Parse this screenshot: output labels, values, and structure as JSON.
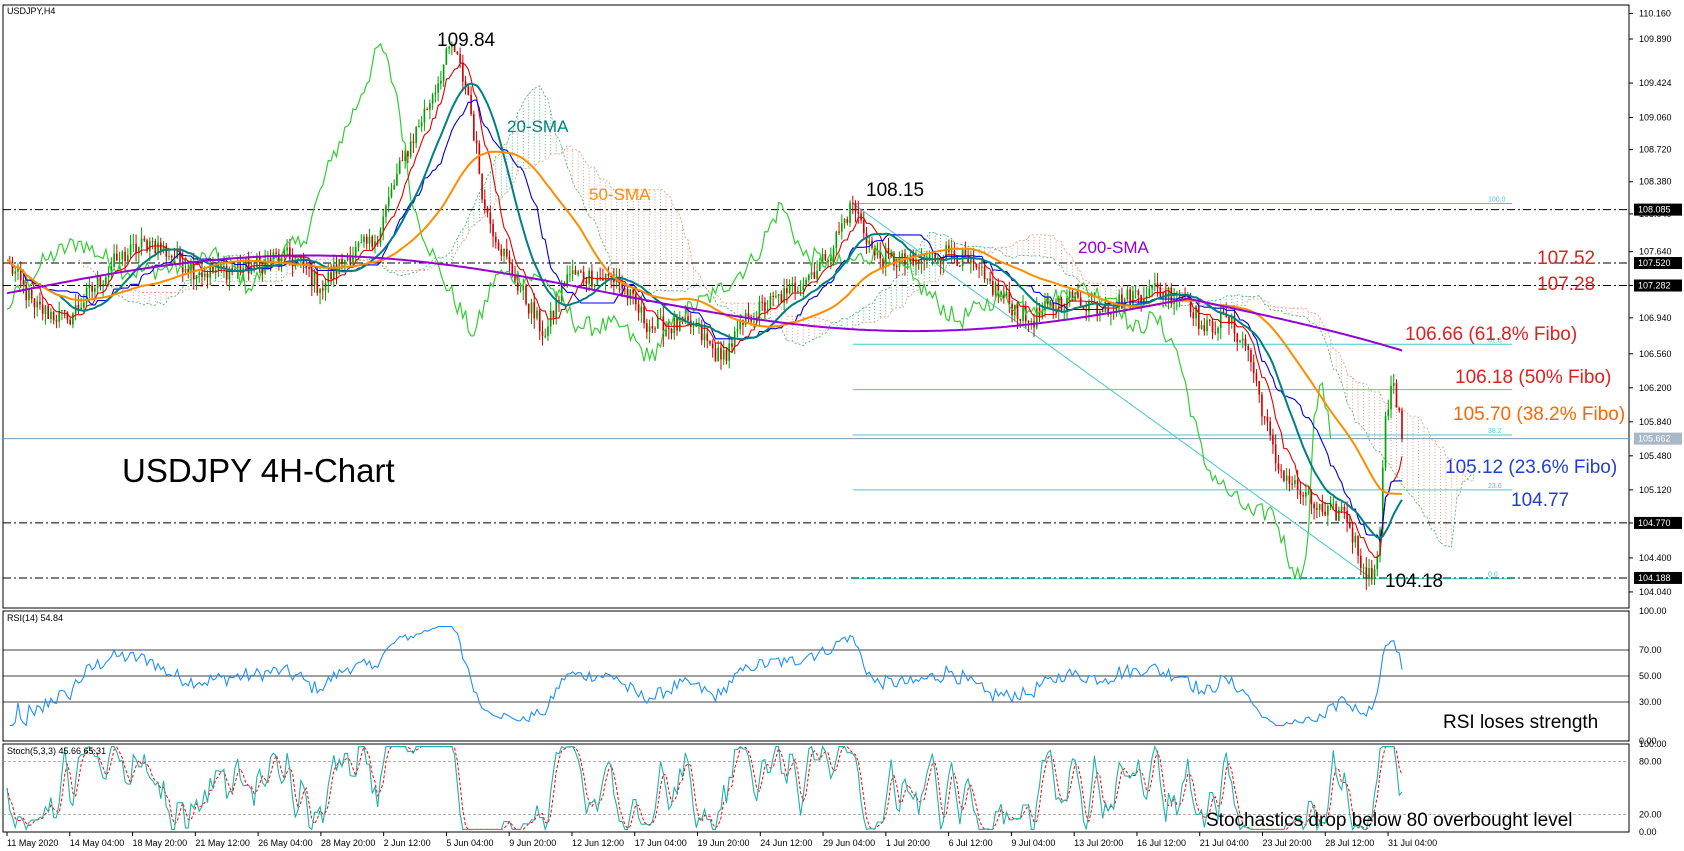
{
  "chart_data": [
    {
      "type": "line",
      "panel": "main",
      "symbol_label": "USDJPY,H4",
      "title": "USDJPY 4H-Chart",
      "ylim": [
        103.87,
        110.25
      ],
      "y_ticks": [
        "110.160",
        "109.890",
        "109.424",
        "109.060",
        "108.720",
        "108.380",
        "108.040",
        "107.640",
        "107.282",
        "106.940",
        "106.560",
        "106.200",
        "105.840",
        "105.480",
        "105.120",
        "104.770",
        "104.400",
        "104.040"
      ],
      "x_ticks": [
        "11 May 2020",
        "14 May 04:00",
        "18 May 20:00",
        "21 May 12:00",
        "26 May 04:00",
        "28 May 20:00",
        "2 Jun 12:00",
        "5 Jun 04:00",
        "9 Jun 20:00",
        "12 Jun 12:00",
        "17 Jun 04:00",
        "19 Jun 20:00",
        "24 Jun 12:00",
        "29 Jun 04:00",
        "1 Jul 20:00",
        "6 Jul 12:00",
        "9 Jul 04:00",
        "13 Jul 20:00",
        "16 Jul 12:00",
        "21 Jul 04:00",
        "23 Jul 20:00",
        "28 Jul 12:00",
        "31 Jul 04:00"
      ],
      "price_boxes": [
        {
          "value": 108.085,
          "label": "108.085"
        },
        {
          "value": 107.52,
          "label": "107.520"
        },
        {
          "value": 107.282,
          "label": "107.282"
        },
        {
          "value": 105.662,
          "label": "105.662"
        },
        {
          "value": 104.77,
          "label": "104.770"
        },
        {
          "value": 104.188,
          "label": "104.188"
        }
      ],
      "horizontal_levels": [
        108.085,
        107.52,
        107.282,
        104.77,
        104.188
      ],
      "current_price": 105.662,
      "fibo": {
        "high": 108.15,
        "low": 104.18,
        "levels": [
          {
            "value": 108.15,
            "small_label": "100.0"
          },
          {
            "value": 106.66,
            "small_label": "61.8"
          },
          {
            "value": 106.18,
            "small_label": ""
          },
          {
            "value": 105.7,
            "small_label": "38.2"
          },
          {
            "value": 105.12,
            "small_label": "23.6"
          },
          {
            "value": 104.18,
            "small_label": "0.0"
          }
        ]
      },
      "annotations": [
        {
          "text": "109.84",
          "color": "#000000"
        },
        {
          "text": "108.15",
          "color": "#000000"
        },
        {
          "text": "104.18",
          "color": "#000000"
        },
        {
          "text": "20-SMA",
          "color": "#008080"
        },
        {
          "text": "50-SMA",
          "color": "#ff8c00"
        },
        {
          "text": "200-SMA",
          "color": "#9400d3"
        },
        {
          "text": "107.52",
          "color": "#e02020"
        },
        {
          "text": "107.28",
          "color": "#e02020"
        },
        {
          "text": "106.66 (61.8% Fibo)",
          "color": "#e02020"
        },
        {
          "text": "106.18 (50% Fibo)",
          "color": "#e02020"
        },
        {
          "text": "105.70 (38.2% Fibo)",
          "color": "#ff6600"
        },
        {
          "text": "105.12 (23.6% Fibo)",
          "color": "#1f3fd1"
        },
        {
          "text": "104.77",
          "color": "#1f3fd1"
        }
      ],
      "anchors": [
        {
          "t": 0,
          "p": 107.55
        },
        {
          "t": 10,
          "p": 107.05
        },
        {
          "t": 22,
          "p": 106.92
        },
        {
          "t": 40,
          "p": 107.55
        },
        {
          "t": 52,
          "p": 107.75
        },
        {
          "t": 70,
          "p": 107.42
        },
        {
          "t": 90,
          "p": 107.48
        },
        {
          "t": 100,
          "p": 107.6
        },
        {
          "t": 108,
          "p": 107.5
        },
        {
          "t": 114,
          "p": 107.25
        },
        {
          "t": 124,
          "p": 107.6
        },
        {
          "t": 134,
          "p": 107.75
        },
        {
          "t": 144,
          "p": 108.6
        },
        {
          "t": 155,
          "p": 109.3
        },
        {
          "t": 162,
          "p": 109.84
        },
        {
          "t": 168,
          "p": 109.3
        },
        {
          "t": 174,
          "p": 108.1
        },
        {
          "t": 184,
          "p": 107.4
        },
        {
          "t": 196,
          "p": 106.75
        },
        {
          "t": 204,
          "p": 107.4
        },
        {
          "t": 222,
          "p": 107.35
        },
        {
          "t": 234,
          "p": 106.85
        },
        {
          "t": 250,
          "p": 106.85
        },
        {
          "t": 260,
          "p": 106.5
        },
        {
          "t": 270,
          "p": 106.95
        },
        {
          "t": 284,
          "p": 107.2
        },
        {
          "t": 298,
          "p": 107.55
        },
        {
          "t": 308,
          "p": 108.15
        },
        {
          "t": 316,
          "p": 107.6
        },
        {
          "t": 330,
          "p": 107.5
        },
        {
          "t": 344,
          "p": 107.65
        },
        {
          "t": 356,
          "p": 107.35
        },
        {
          "t": 372,
          "p": 106.9
        },
        {
          "t": 386,
          "p": 107.15
        },
        {
          "t": 400,
          "p": 107.05
        },
        {
          "t": 416,
          "p": 107.25
        },
        {
          "t": 430,
          "p": 107.15
        },
        {
          "t": 436,
          "p": 106.8
        },
        {
          "t": 444,
          "p": 106.95
        },
        {
          "t": 452,
          "p": 106.6
        },
        {
          "t": 462,
          "p": 105.4
        },
        {
          "t": 472,
          "p": 105.05
        },
        {
          "t": 480,
          "p": 104.85
        },
        {
          "t": 487,
          "p": 104.9
        },
        {
          "t": 494,
          "p": 104.3
        },
        {
          "t": 497,
          "p": 104.18
        },
        {
          "t": 500,
          "p": 104.7
        },
        {
          "t": 502,
          "p": 105.9
        },
        {
          "t": 505,
          "p": 106.25
        },
        {
          "t": 508,
          "p": 105.66
        }
      ],
      "x_span": [
        0,
        508
      ],
      "indicators": {
        "sma20": {
          "color": "#008080"
        },
        "sma50": {
          "color": "#ff8c00"
        },
        "sma200": {
          "color": "#9400d3"
        },
        "tenkan": {
          "color": "#e00000"
        },
        "kijun": {
          "color": "#0000dd"
        },
        "chikou": {
          "color": "#32cd32"
        }
      }
    },
    {
      "type": "line",
      "panel": "rsi",
      "title": "RSI(14) 54.84",
      "ylim": [
        0,
        100
      ],
      "levels": [
        70,
        50,
        30
      ],
      "y_ticks": [
        "100.00",
        "70.00",
        "50.00",
        "30.00",
        "0.00"
      ],
      "last_value": 54.84,
      "color": "#1e90ff",
      "annotation": "RSI loses strength"
    },
    {
      "type": "line",
      "panel": "stochastic",
      "title": "Stoch(5,3,3) 45.66 65.31",
      "ylim": [
        0,
        100
      ],
      "levels": [
        80,
        20
      ],
      "y_ticks": [
        "100.00",
        "80.00",
        "20.00",
        "0.00"
      ],
      "main_value": 45.66,
      "signal_value": 65.31,
      "main_color": "#20b2aa",
      "signal_color": "#ff0000",
      "annotation": "Stochastics drop below 80 overbought level"
    }
  ]
}
